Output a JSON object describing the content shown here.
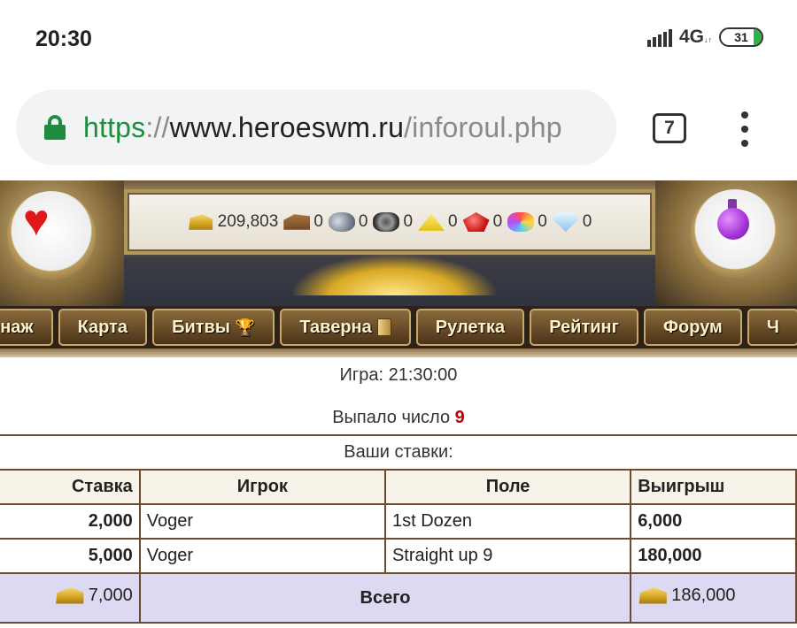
{
  "status_bar": {
    "time": "20:30",
    "network": "4G",
    "battery_level": "31"
  },
  "browser": {
    "url_scheme": "https",
    "url_sep": "://",
    "url_host": "www.heroeswm.ru",
    "url_path": "/inforoul.php",
    "tab_count": "7"
  },
  "resources": [
    {
      "icon": "gold-icon",
      "value": "209,803"
    },
    {
      "icon": "wood-icon",
      "value": "0"
    },
    {
      "icon": "ore-icon",
      "value": "0"
    },
    {
      "icon": "mercury-icon",
      "value": "0"
    },
    {
      "icon": "sulfur-icon",
      "value": "0"
    },
    {
      "icon": "crystal-icon",
      "value": "0"
    },
    {
      "icon": "gems-icon",
      "value": "0"
    },
    {
      "icon": "diamond-icon",
      "value": "0"
    }
  ],
  "nav": {
    "items": [
      "рнаж",
      "Карта",
      "Битвы",
      "Таверна",
      "Рулетка",
      "Рейтинг",
      "Форум",
      "Ч"
    ]
  },
  "game": {
    "time_label": "Игра: 21:30:00",
    "result_label": "Выпало число",
    "result_number": "9",
    "bets_title": "Ваши ставки:"
  },
  "bets_table": {
    "headers": [
      "Ставка",
      "Игрок",
      "Поле",
      "Выигрыш"
    ],
    "rows": [
      [
        "2,000",
        "Voger",
        "1st Dozen",
        "6,000"
      ],
      [
        "5,000",
        "Voger",
        "Straight up 9",
        "180,000"
      ]
    ],
    "total": {
      "stake": "7,000",
      "label": "Всего",
      "win": "186,000"
    }
  }
}
